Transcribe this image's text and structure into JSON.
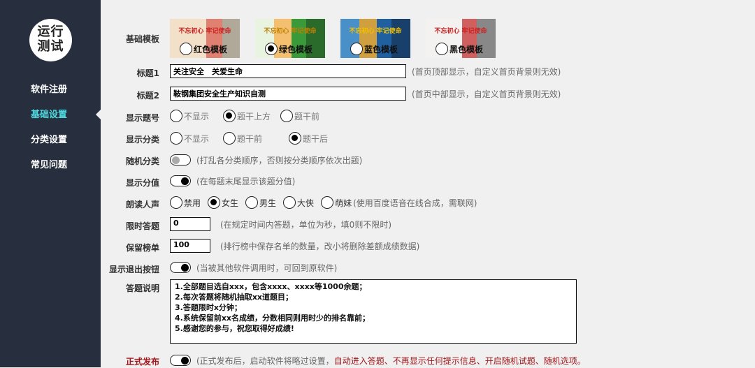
{
  "logo": {
    "line1": "运行",
    "line2": "测试"
  },
  "sidebar": {
    "items": [
      {
        "label": "软件注册"
      },
      {
        "label": "基础设置"
      },
      {
        "label": "分类设置"
      },
      {
        "label": "常见问题"
      }
    ],
    "active_index": 1
  },
  "colors": {
    "sidebar": "#272f3e",
    "active": "#4dd9e0",
    "warning": "#a0161a"
  },
  "templates": {
    "label": "基础模板",
    "banner": "不忘初心 牢记使命",
    "items": [
      {
        "label": "红色模板",
        "selected": false
      },
      {
        "label": "绿色模板",
        "selected": true
      },
      {
        "label": "蓝色模板",
        "selected": false
      },
      {
        "label": "黑色模板",
        "selected": false
      }
    ]
  },
  "title1": {
    "label": "标题1",
    "value": "关注安全　关爱生命",
    "hint": "(首页顶部显示，自定义首页背景则无效)"
  },
  "title2": {
    "label": "标题2",
    "value": "鞍钢集团安全生产知识自测",
    "hint": "(首页中部显示，自定义首页背景则无效)"
  },
  "show_number": {
    "label": "显示题号",
    "options": [
      "不显示",
      "题干上方",
      "题干前"
    ],
    "selected": 1
  },
  "show_category": {
    "label": "显示分类",
    "options": [
      "不显示",
      "题干前",
      "题干后"
    ],
    "selected": 2
  },
  "random_category": {
    "label": "随机分类",
    "on": false,
    "hint": "(打乱各分类顺序，否则按分类顺序依次出题)"
  },
  "show_score": {
    "label": "显示分值",
    "on": true,
    "hint": "(在每题末尾显示该题分值)"
  },
  "voice": {
    "label": "朗读人声",
    "options": [
      "禁用",
      "女生",
      "男生",
      "大侠",
      "萌妹"
    ],
    "selected": 1,
    "hint": "(使用百度语音在线合成，需联网)"
  },
  "time_limit": {
    "label": "限时答题",
    "value": "0",
    "hint": "(在规定时间内答题，单位为秒，填0则不限时)"
  },
  "leaderboard": {
    "label": "保留榜单",
    "value": "100",
    "hint": "(排行榜中保存名单的数量，改小将删除差额成绩数据)"
  },
  "exit_button": {
    "label": "显示退出按钮",
    "on": true,
    "hint": "(当被其他软件调用时，可回到原软件)"
  },
  "description": {
    "label": "答题说明",
    "lines": [
      "1.全部题目选自xxx，包含xxxx、xxxx等1000余题；",
      "2.每次答题将随机抽取xx道题目；",
      "3.答题限时x分钟；",
      "4.系统保留前xx名成绩，分数相同则用时少的排名靠前；",
      "5.感谢您的参与，祝您取得好成绩!"
    ]
  },
  "publish": {
    "label": "正式发布",
    "on": true,
    "hint": "(正式发布后，启动软件将略过设置，",
    "hint_red": "自动进入答题、不再显示任何提示信息、开启随机试题、随机选项。"
  }
}
